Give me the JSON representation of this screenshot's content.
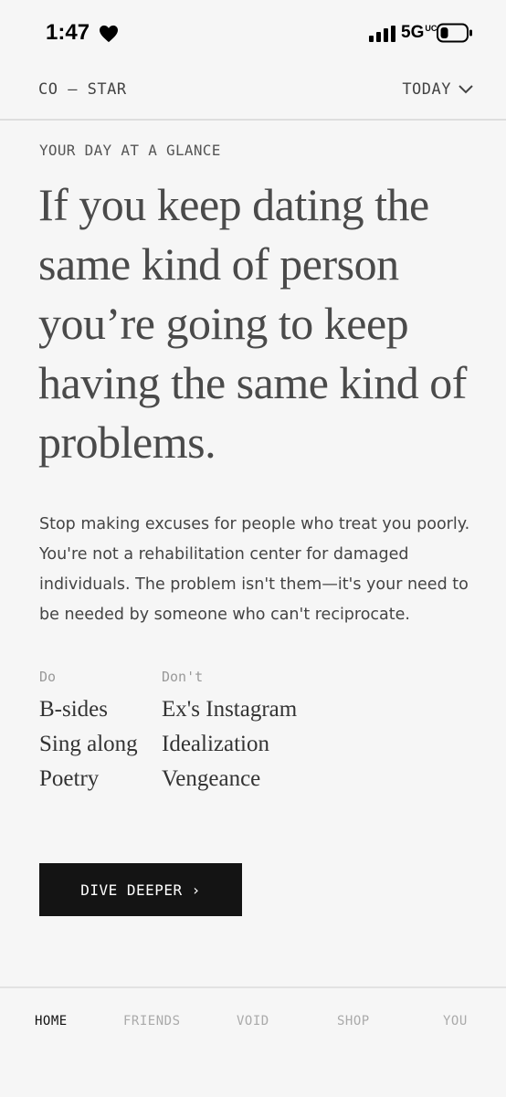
{
  "status_bar": {
    "time": "1:47",
    "network": "5G",
    "network_sup": "UC"
  },
  "header": {
    "brand": "CO — STAR",
    "date_select": "TODAY"
  },
  "main": {
    "kicker": "YOUR DAY AT A GLANCE",
    "headline": "If you keep dating the same kind of person you’re going to keep having the same kind of problems.",
    "body": "Stop making excuses for people who treat you poorly. You're not a rehabilitation center for damaged individuals. The problem isn't them—it's your need to be needed by someone who can't reciprocate.",
    "do": {
      "label": "Do",
      "items": [
        "B-sides",
        "Sing along",
        "Poetry"
      ]
    },
    "dont": {
      "label": "Don't",
      "items": [
        "Ex's Instagram",
        "Idealization",
        "Vengeance"
      ]
    },
    "cta": {
      "label": "DIVE DEEPER",
      "arrow": "›"
    }
  },
  "tabbar": {
    "tabs": [
      {
        "label": "HOME",
        "active": true
      },
      {
        "label": "FRIENDS",
        "active": false
      },
      {
        "label": "VOID",
        "active": false
      },
      {
        "label": "SHOP",
        "active": false
      },
      {
        "label": "YOU",
        "active": false
      }
    ]
  },
  "colors": {
    "background": "#f6f6f6",
    "button": "#141414",
    "headline": "#4a4a4a"
  }
}
